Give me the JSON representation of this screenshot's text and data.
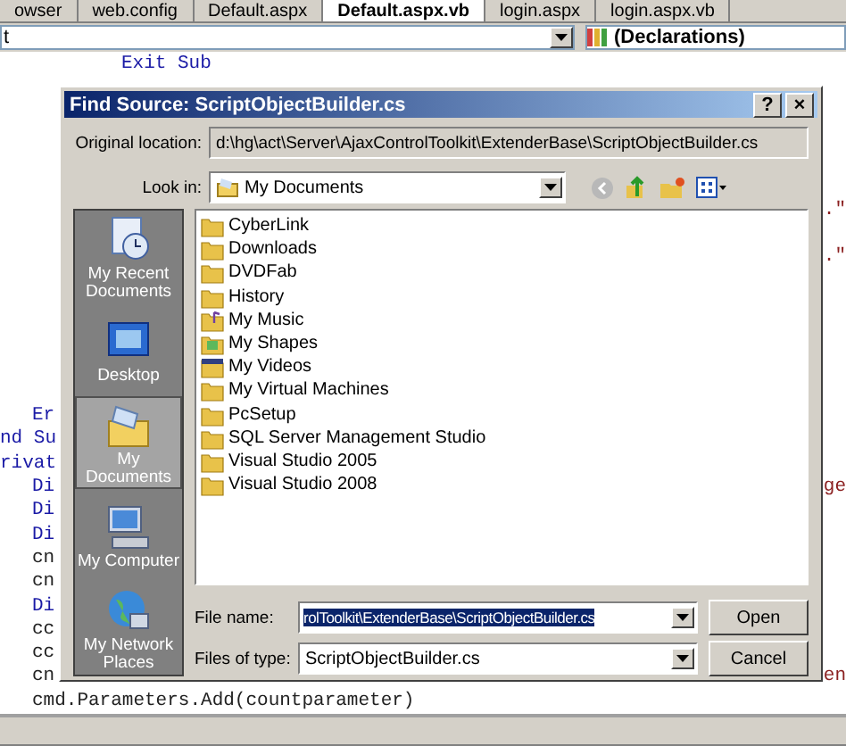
{
  "editor": {
    "tabs": [
      {
        "label": "owser",
        "selected": false
      },
      {
        "label": "web.config",
        "selected": false
      },
      {
        "label": "Default.aspx",
        "selected": false
      },
      {
        "label": "Default.aspx.vb",
        "selected": true
      },
      {
        "label": "login.aspx",
        "selected": false
      },
      {
        "label": "login.aspx.vb",
        "selected": false
      }
    ],
    "member_dropdown": {
      "value": "t"
    },
    "declarations_dropdown": {
      "value": "(Declarations)"
    },
    "exit_line": "Exit Sub",
    "right_fragments": [
      ".\"",
      ".\""
    ],
    "code_lines": [
      {
        "left": "Er",
        "kind": "statement"
      },
      {
        "left": "nd Su",
        "kind": "block"
      },
      {
        "left": "rivat",
        "kind": "block"
      },
      {
        "left": "Di",
        "kind": "statement",
        "right": "ge"
      },
      {
        "left": "Di",
        "kind": "statement"
      },
      {
        "left": "Di",
        "kind": "statement"
      },
      {
        "left": "cn",
        "kind": "call"
      },
      {
        "left": "cn",
        "kind": "call"
      },
      {
        "left": "Di",
        "kind": "statement"
      },
      {
        "left": "cc",
        "kind": "call"
      },
      {
        "left": "cc",
        "kind": "call"
      },
      {
        "left": "cn",
        "kind": "call",
        "right": "en"
      },
      {
        "left": "cmd.Parameters.Add(countparameter)",
        "kind": "call"
      }
    ]
  },
  "dialog": {
    "title": "Find Source: ScriptObjectBuilder.cs",
    "help_button": "?",
    "close_button": "×",
    "original_location": {
      "label": "Original location:",
      "value": "d:\\hg\\act\\Server\\AjaxControlToolkit\\ExtenderBase\\ScriptObjectBuilder.cs"
    },
    "look_in": {
      "label": "Look in:",
      "value": "My Documents"
    },
    "places": [
      {
        "label": "My Recent Documents",
        "kind": "recent",
        "selected": false
      },
      {
        "label": "Desktop",
        "kind": "desktop",
        "selected": false
      },
      {
        "label": "My Documents",
        "kind": "documents",
        "selected": true
      },
      {
        "label": "My Computer",
        "kind": "computer",
        "selected": false
      },
      {
        "label": "My Network Places",
        "kind": "network",
        "selected": false
      }
    ],
    "files": [
      {
        "name": "CyberLink",
        "kind": "folder"
      },
      {
        "name": "Downloads",
        "kind": "folder"
      },
      {
        "name": "DVDFab",
        "kind": "folder"
      },
      {
        "name": "History",
        "kind": "folder"
      },
      {
        "name": "My Music",
        "kind": "music"
      },
      {
        "name": "My Shapes",
        "kind": "shapes"
      },
      {
        "name": "My Videos",
        "kind": "videos"
      },
      {
        "name": "My Virtual Machines",
        "kind": "folder"
      },
      {
        "name": "PcSetup",
        "kind": "folder"
      },
      {
        "name": "SQL Server Management Studio",
        "kind": "folder"
      },
      {
        "name": "Visual Studio 2005",
        "kind": "folder"
      },
      {
        "name": "Visual Studio 2008",
        "kind": "folder"
      }
    ],
    "file_name": {
      "label": "File name:",
      "value": "rolToolkit\\ExtenderBase\\ScriptObjectBuilder.cs"
    },
    "files_of_type": {
      "label": "Files of type:",
      "value": "ScriptObjectBuilder.cs"
    },
    "buttons": [
      "Open",
      "Cancel"
    ]
  }
}
